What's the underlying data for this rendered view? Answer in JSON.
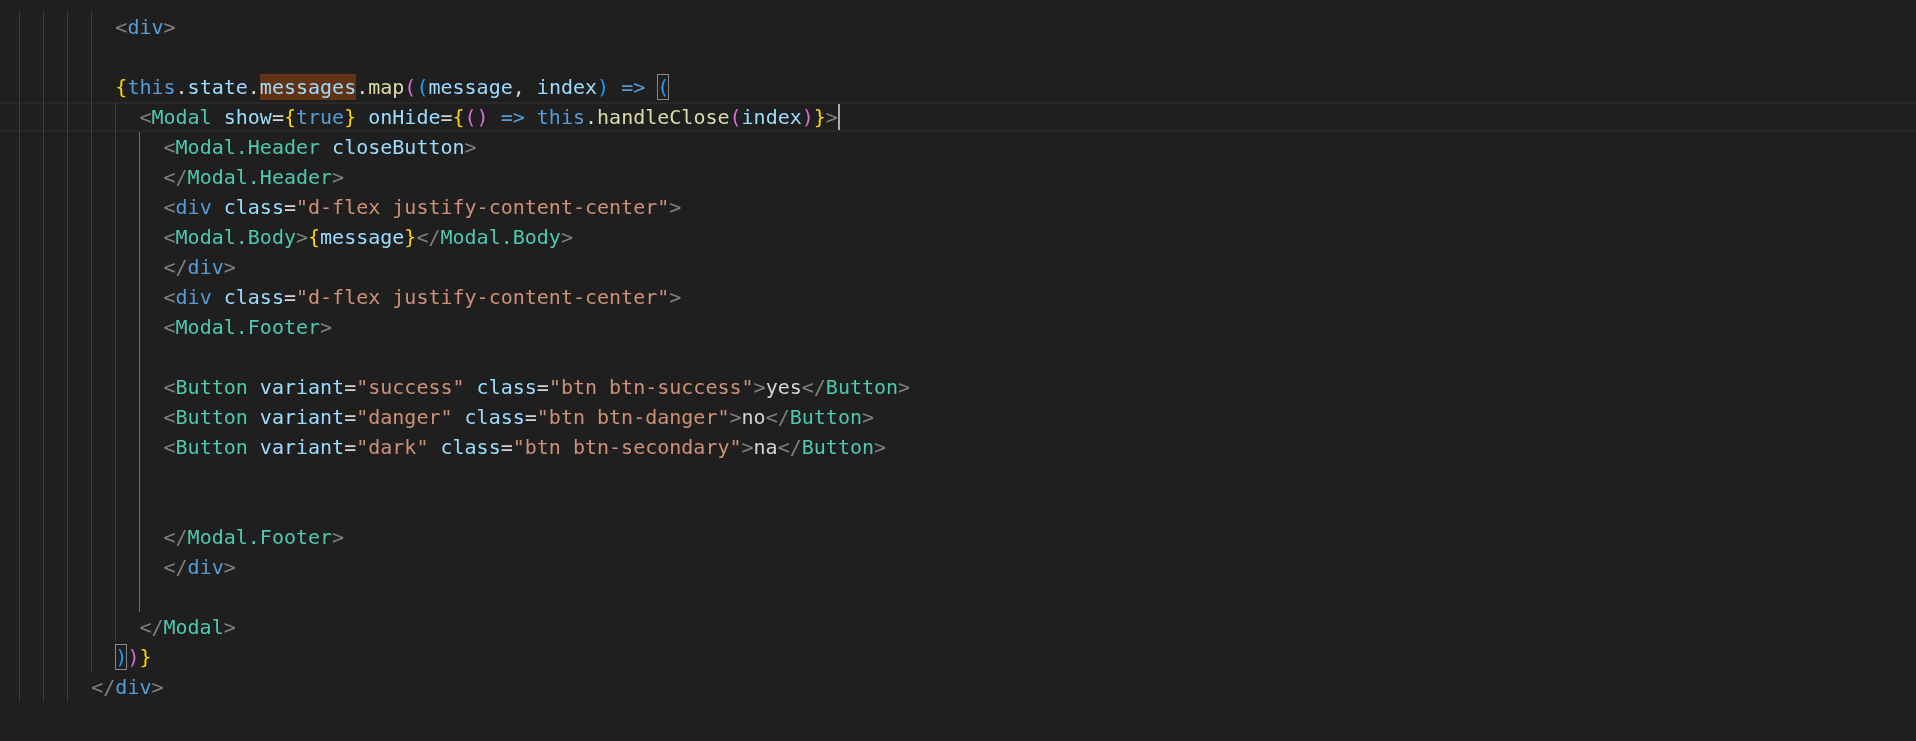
{
  "editor": {
    "lines": [
      {
        "children": [
          {
            "tokens": [
              {
                "kind": "punct",
                "text": "<"
              },
              {
                "kind": "htmltag",
                "text": "div"
              },
              {
                "kind": "punct",
                "text": ">"
              }
            ]
          },
          {
            "kind": "blank"
          },
          {
            "tokens": [
              {
                "kind": "brace1",
                "text": "{"
              },
              {
                "kind": "keyword",
                "text": "this"
              },
              {
                "kind": "plain",
                "text": "."
              },
              {
                "kind": "var",
                "text": "state"
              },
              {
                "kind": "plain",
                "text": "."
              },
              {
                "kind": "var",
                "text": "messages",
                "find_match": true
              },
              {
                "kind": "plain",
                "text": "."
              },
              {
                "kind": "func",
                "text": "map"
              },
              {
                "kind": "brace2",
                "text": "("
              },
              {
                "kind": "brace3",
                "text": "("
              },
              {
                "kind": "var",
                "text": "message"
              },
              {
                "kind": "plain",
                "text": ", "
              },
              {
                "kind": "var",
                "text": "index"
              },
              {
                "kind": "brace3",
                "text": ") "
              },
              {
                "kind": "keyword",
                "text": "=> "
              },
              {
                "kind": "brace3",
                "text": "(",
                "bracket_match": true
              }
            ],
            "children": [
              {
                "current": true,
                "cursor": true,
                "active_guide": true,
                "tokens": [
                  {
                    "kind": "punct",
                    "text": "<"
                  },
                  {
                    "kind": "tag",
                    "text": "Modal "
                  },
                  {
                    "kind": "attr",
                    "text": "show"
                  },
                  {
                    "kind": "plain",
                    "text": "="
                  },
                  {
                    "kind": "brace1",
                    "text": "{"
                  },
                  {
                    "kind": "keyword",
                    "text": "true"
                  },
                  {
                    "kind": "brace1",
                    "text": "} "
                  },
                  {
                    "kind": "attr",
                    "text": "onHide"
                  },
                  {
                    "kind": "plain",
                    "text": "="
                  },
                  {
                    "kind": "brace1",
                    "text": "{"
                  },
                  {
                    "kind": "brace2",
                    "text": "() "
                  },
                  {
                    "kind": "keyword",
                    "text": "=> "
                  },
                  {
                    "kind": "keyword",
                    "text": "this"
                  },
                  {
                    "kind": "plain",
                    "text": "."
                  },
                  {
                    "kind": "func",
                    "text": "handleClose"
                  },
                  {
                    "kind": "brace2",
                    "text": "("
                  },
                  {
                    "kind": "var",
                    "text": "index"
                  },
                  {
                    "kind": "brace2",
                    "text": ")"
                  },
                  {
                    "kind": "brace1",
                    "text": "}"
                  },
                  {
                    "kind": "punct",
                    "text": ">"
                  }
                ],
                "children": [
                  {
                    "tokens": [
                      {
                        "kind": "punct",
                        "text": "<"
                      },
                      {
                        "kind": "tag",
                        "text": "Modal.Header "
                      },
                      {
                        "kind": "attr",
                        "text": "closeButton"
                      },
                      {
                        "kind": "punct",
                        "text": ">"
                      }
                    ]
                  },
                  {
                    "tokens": [
                      {
                        "kind": "punct",
                        "text": "</"
                      },
                      {
                        "kind": "tag",
                        "text": "Modal.Header"
                      },
                      {
                        "kind": "punct",
                        "text": ">"
                      }
                    ]
                  },
                  {
                    "tokens": [
                      {
                        "kind": "punct",
                        "text": "<"
                      },
                      {
                        "kind": "htmltag",
                        "text": "div "
                      },
                      {
                        "kind": "attr",
                        "text": "class"
                      },
                      {
                        "kind": "plain",
                        "text": "="
                      },
                      {
                        "kind": "string",
                        "text": "\"d-flex justify-content-center\""
                      },
                      {
                        "kind": "punct",
                        "text": ">"
                      }
                    ]
                  },
                  {
                    "tokens": [
                      {
                        "kind": "punct",
                        "text": "<"
                      },
                      {
                        "kind": "tag",
                        "text": "Modal.Body"
                      },
                      {
                        "kind": "punct",
                        "text": ">"
                      },
                      {
                        "kind": "brace1",
                        "text": "{"
                      },
                      {
                        "kind": "var",
                        "text": "message"
                      },
                      {
                        "kind": "brace1",
                        "text": "}"
                      },
                      {
                        "kind": "punct",
                        "text": "</"
                      },
                      {
                        "kind": "tag",
                        "text": "Modal.Body"
                      },
                      {
                        "kind": "punct",
                        "text": ">"
                      }
                    ]
                  },
                  {
                    "tokens": [
                      {
                        "kind": "punct",
                        "text": "</"
                      },
                      {
                        "kind": "htmltag",
                        "text": "div"
                      },
                      {
                        "kind": "punct",
                        "text": ">"
                      }
                    ]
                  },
                  {
                    "tokens": [
                      {
                        "kind": "punct",
                        "text": "<"
                      },
                      {
                        "kind": "htmltag",
                        "text": "div "
                      },
                      {
                        "kind": "attr",
                        "text": "class"
                      },
                      {
                        "kind": "plain",
                        "text": "="
                      },
                      {
                        "kind": "string",
                        "text": "\"d-flex justify-content-center\""
                      },
                      {
                        "kind": "punct",
                        "text": ">"
                      }
                    ]
                  },
                  {
                    "tokens": [
                      {
                        "kind": "punct",
                        "text": "<"
                      },
                      {
                        "kind": "tag",
                        "text": "Modal.Footer"
                      },
                      {
                        "kind": "punct",
                        "text": ">"
                      }
                    ]
                  },
                  {
                    "kind": "blank"
                  },
                  {
                    "tokens": [
                      {
                        "kind": "punct",
                        "text": "<"
                      },
                      {
                        "kind": "tag",
                        "text": "Button "
                      },
                      {
                        "kind": "attr",
                        "text": "variant"
                      },
                      {
                        "kind": "plain",
                        "text": "="
                      },
                      {
                        "kind": "string",
                        "text": "\"success\" "
                      },
                      {
                        "kind": "attr",
                        "text": "class"
                      },
                      {
                        "kind": "plain",
                        "text": "="
                      },
                      {
                        "kind": "string",
                        "text": "\"btn btn-success\""
                      },
                      {
                        "kind": "punct",
                        "text": ">"
                      },
                      {
                        "kind": "text",
                        "text": "yes"
                      },
                      {
                        "kind": "punct",
                        "text": "</"
                      },
                      {
                        "kind": "tag",
                        "text": "Button"
                      },
                      {
                        "kind": "punct",
                        "text": ">"
                      }
                    ]
                  },
                  {
                    "tokens": [
                      {
                        "kind": "punct",
                        "text": "<"
                      },
                      {
                        "kind": "tag",
                        "text": "Button "
                      },
                      {
                        "kind": "attr",
                        "text": "variant"
                      },
                      {
                        "kind": "plain",
                        "text": "="
                      },
                      {
                        "kind": "string",
                        "text": "\"danger\" "
                      },
                      {
                        "kind": "attr",
                        "text": "class"
                      },
                      {
                        "kind": "plain",
                        "text": "="
                      },
                      {
                        "kind": "string",
                        "text": "\"btn btn-danger\""
                      },
                      {
                        "kind": "punct",
                        "text": ">"
                      },
                      {
                        "kind": "text",
                        "text": "no"
                      },
                      {
                        "kind": "punct",
                        "text": "</"
                      },
                      {
                        "kind": "tag",
                        "text": "Button"
                      },
                      {
                        "kind": "punct",
                        "text": ">"
                      }
                    ]
                  },
                  {
                    "tokens": [
                      {
                        "kind": "punct",
                        "text": "<"
                      },
                      {
                        "kind": "tag",
                        "text": "Button "
                      },
                      {
                        "kind": "attr",
                        "text": "variant"
                      },
                      {
                        "kind": "plain",
                        "text": "="
                      },
                      {
                        "kind": "string",
                        "text": "\"dark\" "
                      },
                      {
                        "kind": "attr",
                        "text": "class"
                      },
                      {
                        "kind": "plain",
                        "text": "="
                      },
                      {
                        "kind": "string",
                        "text": "\"btn btn-secondary\""
                      },
                      {
                        "kind": "punct",
                        "text": ">"
                      },
                      {
                        "kind": "text",
                        "text": "na"
                      },
                      {
                        "kind": "punct",
                        "text": "</"
                      },
                      {
                        "kind": "tag",
                        "text": "Button"
                      },
                      {
                        "kind": "punct",
                        "text": ">"
                      }
                    ]
                  },
                  {
                    "kind": "blank"
                  },
                  {
                    "kind": "blank"
                  },
                  {
                    "tokens": [
                      {
                        "kind": "punct",
                        "text": "</"
                      },
                      {
                        "kind": "tag",
                        "text": "Modal.Footer"
                      },
                      {
                        "kind": "punct",
                        "text": ">"
                      }
                    ]
                  },
                  {
                    "tokens": [
                      {
                        "kind": "punct",
                        "text": "</"
                      },
                      {
                        "kind": "htmltag",
                        "text": "div"
                      },
                      {
                        "kind": "punct",
                        "text": ">"
                      }
                    ]
                  },
                  {
                    "kind": "blank"
                  }
                ]
              },
              {
                "tokens": [
                  {
                    "kind": "punct",
                    "text": "</"
                  },
                  {
                    "kind": "tag",
                    "text": "Modal"
                  },
                  {
                    "kind": "punct",
                    "text": ">"
                  }
                ]
              }
            ]
          },
          {
            "tokens": [
              {
                "kind": "brace3",
                "text": ")",
                "bracket_match": true
              },
              {
                "kind": "brace2",
                "text": ")"
              },
              {
                "kind": "brace1",
                "text": "}"
              }
            ]
          }
        ]
      },
      {
        "tokens": [
          {
            "kind": "punct",
            "text": "</"
          },
          {
            "kind": "htmltag",
            "text": "div"
          },
          {
            "kind": "punct",
            "text": ">"
          }
        ]
      }
    ]
  }
}
